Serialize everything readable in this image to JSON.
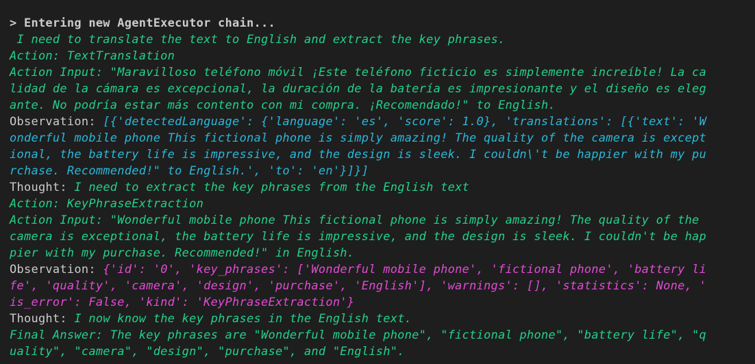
{
  "terminal": {
    "header": "> Entering new AgentExecutor chain...",
    "lines": [
      " I need to translate the text to English and extract the key phrases.",
      "Action: TextTranslation",
      "Action Input: \"Maravilloso teléfono móvil ¡Este teléfono ficticio es simplemente increíble! La ca",
      "lidad de la cámara es excepcional, la duración de la batería es impresionante y el diseño es eleg",
      "ante. No podría estar más contento con mi compra. ¡Recomendado!\" to English.",
      "Observation: ",
      "[{'detectedLanguage': {'language': 'es', 'score': 1.0}, 'translations': [{'text': 'W",
      "onderful mobile phone This fictional phone is simply amazing! The quality of the camera is except",
      "ional, the battery life is impressive, and the design is sleek. I couldn\\'t be happier with my pu",
      "rchase. Recommended!\" to English.', 'to': 'en'}]}]",
      "Thought: ",
      "I need to extract the key phrases from the English text",
      "Action: KeyPhraseExtraction",
      "Action Input: \"Wonderful mobile phone This fictional phone is simply amazing! The quality of the",
      "camera is exceptional, the battery life is impressive, and the design is sleek. I couldn't be hap",
      "pier with my purchase. Recommended!\" in English.",
      "Observation: ",
      "{'id': '0', 'key_phrases': ['Wonderful mobile phone', 'fictional phone', 'battery li",
      "fe', 'quality', 'camera', 'design', 'purchase', 'English'], 'warnings': [], 'statistics': None, '",
      "is_error': False, 'kind': 'KeyPhraseExtraction'}",
      "Thought: ",
      "I now know the key phrases in the English text.",
      "Final Answer: The key phrases are \"Wonderful mobile phone\", \"fictional phone\", \"battery life\", \"q",
      "uality\", \"camera\", \"design\", \"purchase\", and \"English\"."
    ]
  }
}
